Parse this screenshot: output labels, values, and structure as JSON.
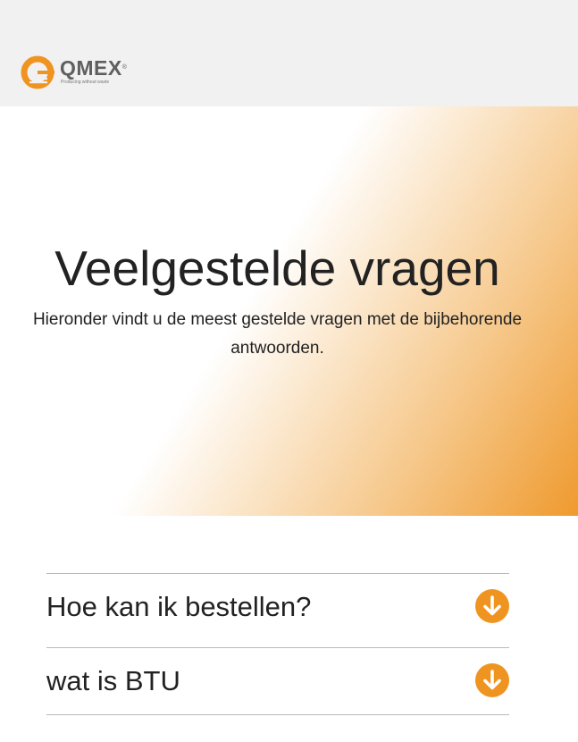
{
  "header": {
    "logo_text": "QMEX",
    "logo_tagline": "Producing without waste",
    "logo_registered": "®",
    "brand_color": "#ef9420"
  },
  "hero": {
    "title": "Veelgestelde vragen",
    "subtitle": "Hieronder vindt u de meest gestelde vragen met de bijbehorende antwoorden."
  },
  "faq": {
    "items": [
      {
        "question": "Hoe kan ik bestellen?",
        "icon": "arrow-down-circle-icon",
        "expanded": false
      },
      {
        "question": "wat is BTU",
        "icon": "arrow-down-circle-icon",
        "expanded": false
      }
    ]
  }
}
